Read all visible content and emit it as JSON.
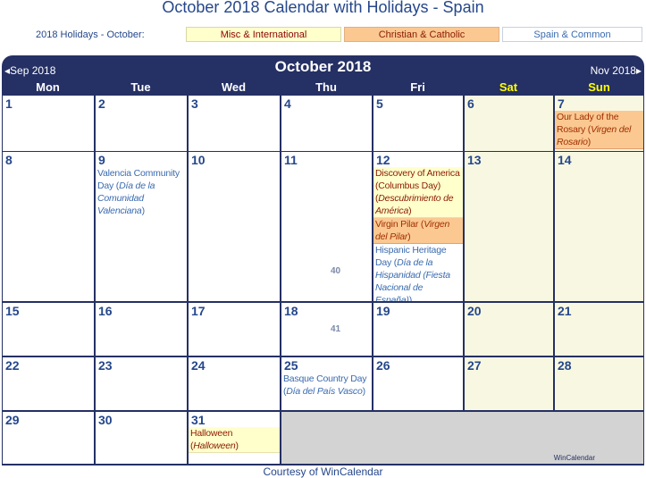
{
  "title": "October 2018 Calendar with Holidays - Spain",
  "legend": {
    "label": "2018 Holidays - October:",
    "items": [
      {
        "label": "Misc & International",
        "color": "#ffffcc"
      },
      {
        "label": "Christian & Catholic",
        "color": "#fbc892"
      },
      {
        "label": "Spain & Common",
        "color": "#ffffff"
      }
    ]
  },
  "calendar": {
    "month_title": "October 2018",
    "prev_label": "◂Sep 2018",
    "next_label": "Nov 2018▸",
    "weekdays": [
      "Mon",
      "Tue",
      "Wed",
      "Thu",
      "Fri",
      "Sat",
      "Sun"
    ],
    "week_numbers": [
      "40",
      "41"
    ],
    "days": {
      "d1": "1",
      "d2": "2",
      "d3": "3",
      "d4": "4",
      "d5": "5",
      "d6": "6",
      "d7": "7",
      "d8": "8",
      "d9": "9",
      "d10": "10",
      "d11": "11",
      "d12": "12",
      "d13": "13",
      "d14": "14",
      "d15": "15",
      "d16": "16",
      "d17": "17",
      "d18": "18",
      "d19": "19",
      "d20": "20",
      "d21": "21",
      "d22": "22",
      "d23": "23",
      "d24": "24",
      "d25": "25",
      "d26": "26",
      "d27": "27",
      "d28": "28",
      "d29": "29",
      "d30": "30",
      "d31": "31"
    },
    "events": {
      "d7_a": "Our Lady of the Rosary (",
      "d7_b": "Virgen del Rosario",
      "d7_c": ")",
      "d9_a": "Valencia Community Day (",
      "d9_b": "Día de la Comunidad Valenciana",
      "d9_c": ")",
      "d12a_a": "Discovery of America (Columbus Day) (",
      "d12a_b": "Descubrimiento de América",
      "d12a_c": ")",
      "d12b_a": "Virgin Pilar (",
      "d12b_b": "Virgen del Pilar",
      "d12b_c": ")",
      "d12c_a": "Hispanic Heritage Day (",
      "d12c_b": "Día de la Hispanidad (Fiesta Nacional de España)",
      "d12c_c": ")",
      "d25_a": "Basque Country Day (",
      "d25_b": "Día del País Vasco",
      "d25_c": ")",
      "d31_a": "Halloween (",
      "d31_b": "Halloween",
      "d31_c": ")"
    },
    "watermark": "WinCalendar"
  },
  "footer": "Courtesy of WinCalendar"
}
